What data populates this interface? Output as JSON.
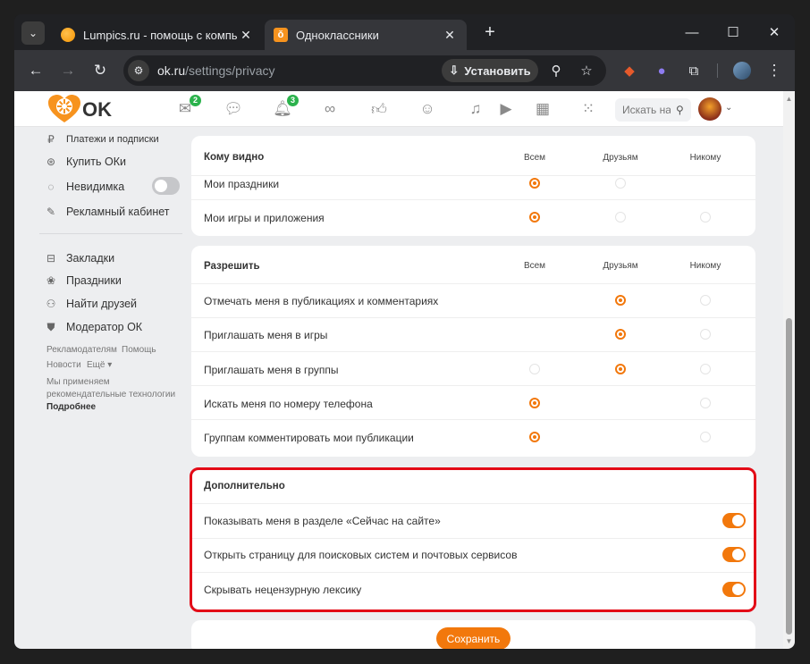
{
  "browser": {
    "tabs": [
      {
        "title": "Lumpics.ru - помощь с компь",
        "active": false
      },
      {
        "title": "Одноклассники",
        "active": true
      }
    ],
    "url_host": "ok.ru",
    "url_path": "/settings/privacy",
    "install_label": "Установить"
  },
  "header": {
    "logo_text": "OK",
    "mail_badge": "2",
    "notifications_badge": "3",
    "search_placeholder": "Искать на"
  },
  "sidebar": {
    "cut_item": "Платежи и подписки",
    "buy_ok": "Купить ОКи",
    "invisible": "Невидимка",
    "ad_cabinet": "Рекламный кабинет",
    "bookmarks": "Закладки",
    "holidays": "Праздники",
    "find_friends": "Найти друзей",
    "moderator": "Модератор ОК",
    "footer": {
      "advertisers": "Рекламодателям",
      "help": "Помощь",
      "news": "Новости",
      "more": "Ещё ▾",
      "notice": "Мы применяем рекомендательные технологии",
      "details": "Подробнее"
    }
  },
  "privacy": {
    "who_sees": {
      "title": "Кому видно",
      "columns": [
        "Всем",
        "Друзьям",
        "Никому"
      ],
      "rows": [
        {
          "label": "Мои праздники",
          "selected": 0
        },
        {
          "label": "Мои игры и приложения",
          "selected": 0
        }
      ]
    },
    "allow": {
      "title": "Разрешить",
      "columns": [
        "Всем",
        "Друзьям",
        "Никому"
      ],
      "rows": [
        {
          "label": "Отмечать меня в публикациях и комментариях",
          "selected": 1
        },
        {
          "label": "Приглашать меня в игры",
          "selected": 1
        },
        {
          "label": "Приглашать меня в группы",
          "selected": 1
        },
        {
          "label": "Искать меня по номеру телефона",
          "selected": 0
        },
        {
          "label": "Группам комментировать мои публикации",
          "selected": 0
        }
      ]
    },
    "additional": {
      "title": "Дополнительно",
      "rows": [
        {
          "label": "Показывать меня в разделе «Сейчас на сайте»",
          "enabled": true
        },
        {
          "label": "Открыть страницу для поисковых систем и почтовых сервисов",
          "enabled": true
        },
        {
          "label": "Скрывать нецензурную лексику",
          "enabled": true
        }
      ]
    },
    "save_label": "Сохранить"
  },
  "colors": {
    "accent": "#f2780c",
    "highlight": "#e30b17"
  }
}
